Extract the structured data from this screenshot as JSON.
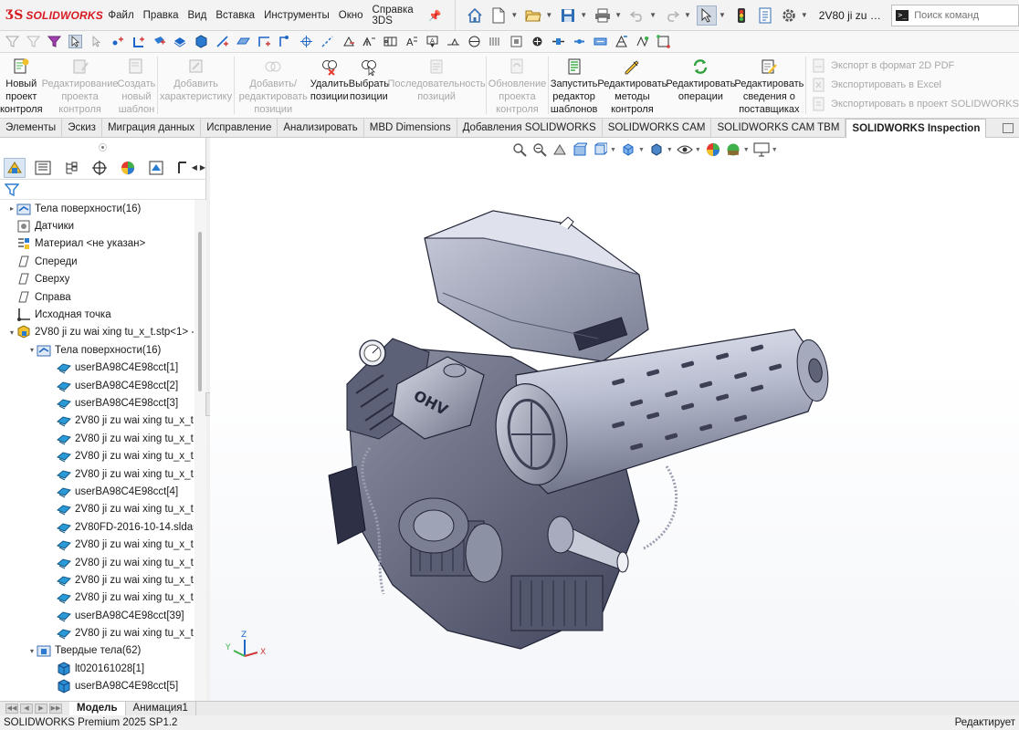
{
  "app": {
    "brand": "SOLIDWORKS",
    "brand_color": "#d71920",
    "document_title": "2V80 ji zu wai ...",
    "command_search_placeholder": "Поиск команд"
  },
  "menu": [
    "Файл",
    "Правка",
    "Вид",
    "Вставка",
    "Инструменты",
    "Окно",
    "Справка 3DS"
  ],
  "ribbon": {
    "buttons": [
      {
        "label": "Новый\nпроект\nконтроля",
        "enabled": true,
        "icon": "new-project-icon"
      },
      {
        "label": "Редактирование\nпроекта\nконтроля",
        "enabled": false,
        "icon": "edit-project-icon"
      },
      {
        "label": "Создать\nновый\nшаблон",
        "enabled": false,
        "icon": "new-template-icon"
      },
      {
        "label": "Добавить\nхарактеристику",
        "enabled": false,
        "icon": "add-characteristic-icon"
      },
      {
        "label": "Добавить/редактировать\nпозиции",
        "enabled": false,
        "icon": "add-balloon-icon"
      },
      {
        "label": "Удалить\nпозиции",
        "enabled": true,
        "icon": "delete-balloon-icon"
      },
      {
        "label": "Выбрать\nпозиции",
        "enabled": true,
        "icon": "select-balloon-icon"
      },
      {
        "label": "Последовательность\nпозиций",
        "enabled": false,
        "icon": "balloon-sequence-icon"
      },
      {
        "label": "Обновление\nпроекта\nконтроля",
        "enabled": false,
        "icon": "update-project-icon"
      },
      {
        "label": "Запустить\nредактор\nшаблонов",
        "enabled": true,
        "icon": "template-editor-icon"
      },
      {
        "label": "Редактировать\nметоды\nконтроля",
        "enabled": true,
        "icon": "edit-methods-icon"
      },
      {
        "label": "Редактировать\nоперации",
        "enabled": true,
        "icon": "edit-operations-icon"
      },
      {
        "label": "Редактировать\nсведения о\nпоставщиках",
        "enabled": true,
        "icon": "edit-vendors-icon"
      }
    ],
    "export": [
      "Экспорт в формат 2D PDF",
      "Экспортировать в Excel",
      "Экспортировать в проект SOLIDWORKS"
    ]
  },
  "tabs": [
    {
      "label": "Элементы",
      "active": false
    },
    {
      "label": "Эскиз",
      "active": false
    },
    {
      "label": "Миграция данных",
      "active": false
    },
    {
      "label": "Исправление",
      "active": false
    },
    {
      "label": "Анализировать",
      "active": false
    },
    {
      "label": "MBD Dimensions",
      "active": false
    },
    {
      "label": "Добавления SOLIDWORKS",
      "active": false
    },
    {
      "label": "SOLIDWORKS CAM",
      "active": false
    },
    {
      "label": "SOLIDWORKS CAM TBM",
      "active": false
    },
    {
      "label": "SOLIDWORKS Inspection",
      "active": true
    }
  ],
  "tree": [
    {
      "level": 0,
      "toggle": "▸",
      "icon": "surface-bodies-folder-icon",
      "label": "Тела поверхности(16)"
    },
    {
      "level": 0,
      "toggle": "",
      "icon": "sensors-icon",
      "label": "Датчики"
    },
    {
      "level": 0,
      "toggle": "",
      "icon": "material-icon",
      "label": "Материал <не указан>"
    },
    {
      "level": 0,
      "toggle": "",
      "icon": "plane-icon",
      "label": "Спереди"
    },
    {
      "level": 0,
      "toggle": "",
      "icon": "plane-icon",
      "label": "Сверху"
    },
    {
      "level": 0,
      "toggle": "",
      "icon": "plane-icon",
      "label": "Справа"
    },
    {
      "level": 0,
      "toggle": "",
      "icon": "origin-icon",
      "label": "Исходная точка"
    },
    {
      "level": 0,
      "toggle": "▾",
      "icon": "imported-feature-icon",
      "label": "2V80 ji zu wai xing tu_x_t.stp<1> -:"
    },
    {
      "level": 1,
      "toggle": "▾",
      "icon": "surface-bodies-folder-icon",
      "label": "Тела поверхности(16)"
    },
    {
      "level": 2,
      "toggle": "",
      "icon": "surface-body-icon",
      "label": "userBA98C4E98cct[1]"
    },
    {
      "level": 2,
      "toggle": "",
      "icon": "surface-body-icon",
      "label": "userBA98C4E98cct[2]"
    },
    {
      "level": 2,
      "toggle": "",
      "icon": "surface-body-icon",
      "label": "userBA98C4E98cct[3]"
    },
    {
      "level": 2,
      "toggle": "",
      "icon": "surface-body-icon",
      "label": "2V80 ji zu wai xing tu_x_t.s"
    },
    {
      "level": 2,
      "toggle": "",
      "icon": "surface-body-icon",
      "label": "2V80 ji zu wai xing tu_x_t.s"
    },
    {
      "level": 2,
      "toggle": "",
      "icon": "surface-body-icon",
      "label": "2V80 ji zu wai xing tu_x_t.s"
    },
    {
      "level": 2,
      "toggle": "",
      "icon": "surface-body-icon",
      "label": "2V80 ji zu wai xing tu_x_t.s"
    },
    {
      "level": 2,
      "toggle": "",
      "icon": "surface-body-icon",
      "label": "userBA98C4E98cct[4]"
    },
    {
      "level": 2,
      "toggle": "",
      "icon": "surface-body-icon",
      "label": "2V80 ji zu wai xing tu_x_t.s"
    },
    {
      "level": 2,
      "toggle": "",
      "icon": "surface-body-icon",
      "label": "2V80FD-2016-10-14.sldas"
    },
    {
      "level": 2,
      "toggle": "",
      "icon": "surface-body-icon",
      "label": "2V80 ji zu wai xing tu_x_t.s"
    },
    {
      "level": 2,
      "toggle": "",
      "icon": "surface-body-icon",
      "label": "2V80 ji zu wai xing tu_x_t.s"
    },
    {
      "level": 2,
      "toggle": "",
      "icon": "surface-body-icon",
      "label": "2V80 ji zu wai xing tu_x_t.s"
    },
    {
      "level": 2,
      "toggle": "",
      "icon": "surface-body-icon",
      "label": "2V80 ji zu wai xing tu_x_t.s"
    },
    {
      "level": 2,
      "toggle": "",
      "icon": "surface-body-icon",
      "label": "userBA98C4E98cct[39]"
    },
    {
      "level": 2,
      "toggle": "",
      "icon": "surface-body-icon",
      "label": "2V80 ji zu wai xing tu_x_t.s"
    },
    {
      "level": 1,
      "toggle": "▾",
      "icon": "solid-bodies-folder-icon",
      "label": "Твердые тела(62)"
    },
    {
      "level": 2,
      "toggle": "",
      "icon": "solid-body-icon",
      "label": "lt020161028[1]"
    },
    {
      "level": 2,
      "toggle": "",
      "icon": "solid-body-icon",
      "label": "userBA98C4E98cct[5]"
    }
  ],
  "bottom_tabs": [
    {
      "label": "Модель",
      "active": true
    },
    {
      "label": "Анимация1",
      "active": false
    }
  ],
  "status": {
    "left": "SOLIDWORKS Premium 2025 SP1.2",
    "right": "Редактирует"
  },
  "triad": {
    "x": "X",
    "y": "Y",
    "z": "Z"
  },
  "model": {
    "emblem": "OHV"
  }
}
